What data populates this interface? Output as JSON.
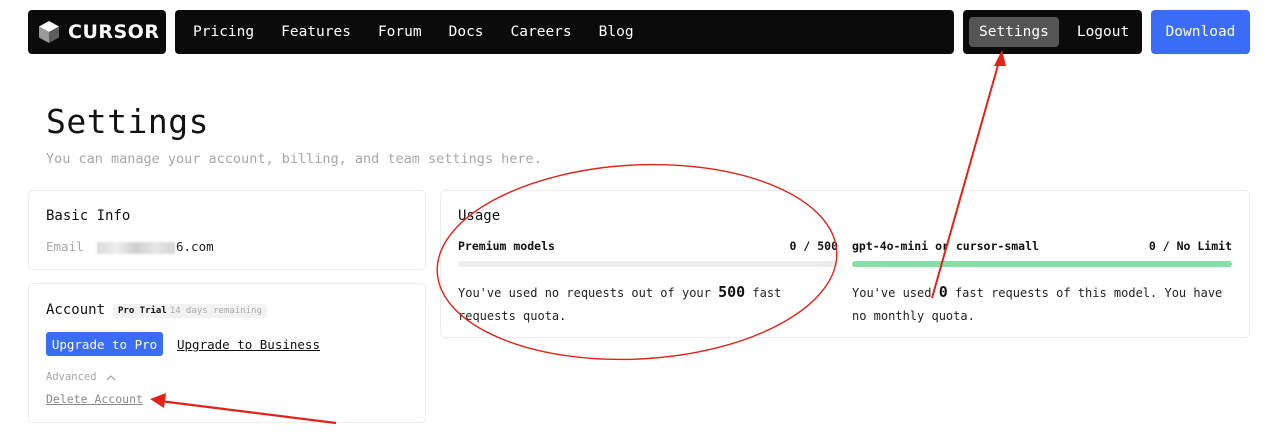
{
  "colors": {
    "accent": "#3b6cf6",
    "nav_bg": "#0b0b0b",
    "nav_active": "#555555",
    "progress_green": "#86e0a6",
    "annotation_red": "#e0231b"
  },
  "brand": {
    "name": "CURSOR",
    "logo_icon": "cube-icon"
  },
  "nav": {
    "links": [
      "Pricing",
      "Features",
      "Forum",
      "Docs",
      "Careers",
      "Blog"
    ],
    "settings": "Settings",
    "logout": "Logout",
    "download": "Download"
  },
  "header": {
    "title": "Settings",
    "subtitle": "You can manage your account, billing, and team settings here."
  },
  "basic_info": {
    "title": "Basic Info",
    "email_label": "Email",
    "email_value_visible": "6.com"
  },
  "account": {
    "title": "Account",
    "plan_badge": "Pro Trial",
    "trial_remaining": "14 days remaining",
    "upgrade_pro": "Upgrade to Pro",
    "upgrade_business": "Upgrade to Business",
    "advanced": "Advanced",
    "advanced_icon": "chevron-up-icon",
    "delete_account": "Delete Account"
  },
  "usage": {
    "title": "Usage",
    "premium": {
      "name": "Premium models",
      "value": "0 / 500",
      "progress_fraction": 0,
      "text_before": "You've used no requests out of your ",
      "highlight": "500",
      "text_after": " fast requests quota."
    },
    "small": {
      "name": "gpt-4o-mini or cursor-small",
      "value": "0 / No Limit",
      "progress_fraction": 1,
      "text_before": "You've used ",
      "highlight": "0",
      "text_after": " fast requests of this model. You have no monthly quota."
    }
  }
}
